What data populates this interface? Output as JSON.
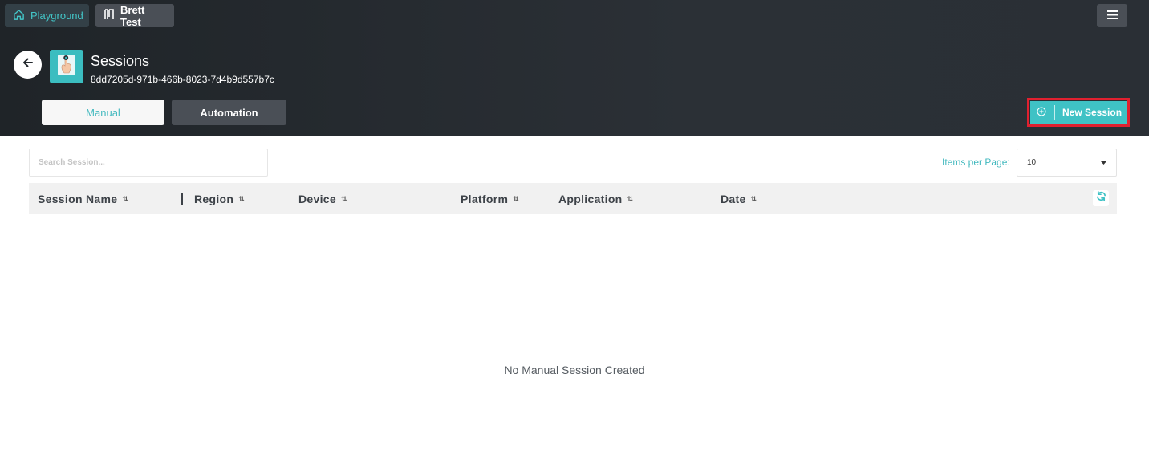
{
  "topbar": {
    "breadcrumbs": [
      {
        "label": "Playground",
        "icon": "home-icon"
      },
      {
        "label": "Brett Test",
        "icon": "project-icon"
      }
    ],
    "menu_icon": "hamburger-menu-icon"
  },
  "page": {
    "title": "Sessions",
    "subtitle": "8dd7205d-971b-466b-8023-7d4b9d557b7c",
    "app_icon": "touch-hand-icon"
  },
  "mode_tabs": [
    {
      "label": "Manual",
      "active": true
    },
    {
      "label": "Automation",
      "active": false
    }
  ],
  "actions": {
    "new_session_label": "New Session",
    "highlight_color": "#e0202f"
  },
  "search": {
    "placeholder": "Search Session..."
  },
  "pagination": {
    "items_per_page_label": "Items per Page:",
    "items_per_page_value": "10"
  },
  "table": {
    "columns": [
      "Session Name",
      "Region",
      "Device",
      "Platform",
      "Application",
      "Date"
    ],
    "empty_message": "No Manual Session Created"
  },
  "colors": {
    "accent": "#43b9bf",
    "header_bg": "#23282d",
    "button_teal": "#3fc2c5"
  }
}
